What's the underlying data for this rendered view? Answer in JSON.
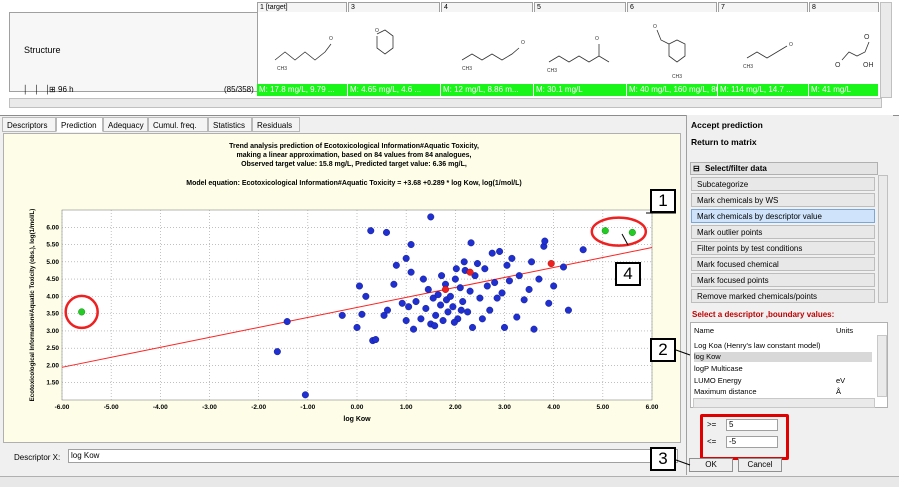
{
  "matrix": {
    "structure_label": "Structure",
    "time_label": "96 h",
    "count_label": "(85/358)",
    "columns": [
      {
        "header": "1 [target]",
        "value": "M: 17.8 mg/L, 9.79 ..."
      },
      {
        "header": "3",
        "value": "M: 4.65 mg/L, 4.6 ..."
      },
      {
        "header": "4",
        "value": "M: 12 mg/L, 8.86 m..."
      },
      {
        "header": "5",
        "value": "M: 30.1 mg/L"
      },
      {
        "header": "6",
        "value": "M: 40 mg/L, 160 mg/L, 80 ..."
      },
      {
        "header": "7",
        "value": "M: 114 mg/L, 14.7 ..."
      },
      {
        "header": "8",
        "value": "M: 41 mg/L"
      }
    ]
  },
  "tabs": [
    {
      "label": "Descriptors"
    },
    {
      "label": "Prediction"
    },
    {
      "label": "Adequacy"
    },
    {
      "label": "Cumul. freq."
    },
    {
      "label": "Statistics"
    },
    {
      "label": "Residuals"
    }
  ],
  "chart_data": {
    "type": "scatter",
    "title_lines": [
      "Trend analysis prediction of Ecotoxicological Information#Aquatic Toxicity,",
      "making a linear approximation, based on 84 values from 84 analogues,",
      "Observed target value: 15.8 mg/L, Predicted target value: 6.36 mg/L,"
    ],
    "equation": "Model equation:  Ecotoxicological Information#Aquatic Toxicity = +3.68 +0.289 * log Kow,  log(1/mol/L)",
    "xlabel": "log Kow",
    "ylabel": "Ecotoxicological Information#Aquatic Toxicity (obs.), log(1/mol/L)",
    "xlim": [
      -6,
      6
    ],
    "ylim": [
      1,
      6.5
    ],
    "xticks": [
      "-6.00",
      "-5.00",
      "-4.00",
      "-3.00",
      "-2.00",
      "-1.00",
      "0.00",
      "1.00",
      "2.00",
      "3.00",
      "4.00",
      "5.00",
      "6.00"
    ],
    "yticks": [
      "1.50",
      "2.00",
      "2.50",
      "3.00",
      "3.50",
      "4.00",
      "4.50",
      "5.00",
      "5.50",
      "6.00"
    ],
    "grid": true,
    "trend_line": {
      "intercept": 3.68,
      "slope": 0.289,
      "color": "#ff2020"
    },
    "colors": {
      "analogue": "#1f2fd0",
      "marked": "#22cc22",
      "target": "#ee2020",
      "highlight": "#ee2020"
    },
    "analogues": [
      {
        "x": -1.62,
        "y": 2.4
      },
      {
        "x": -1.05,
        "y": 1.15
      },
      {
        "x": -1.42,
        "y": 3.27
      },
      {
        "x": 0.0,
        "y": 3.1
      },
      {
        "x": 0.05,
        "y": 4.3
      },
      {
        "x": 0.1,
        "y": 3.48
      },
      {
        "x": 0.18,
        "y": 4.0
      },
      {
        "x": 0.28,
        "y": 5.9
      },
      {
        "x": 0.32,
        "y": 2.72
      },
      {
        "x": 0.38,
        "y": 2.75
      },
      {
        "x": 0.6,
        "y": 5.85
      },
      {
        "x": 0.62,
        "y": 3.6
      },
      {
        "x": 0.75,
        "y": 4.35
      },
      {
        "x": 0.8,
        "y": 4.9
      },
      {
        "x": 0.92,
        "y": 3.8
      },
      {
        "x": 1.0,
        "y": 3.3
      },
      {
        "x": 1.1,
        "y": 4.7
      },
      {
        "x": 1.15,
        "y": 3.05
      },
      {
        "x": 1.2,
        "y": 3.85
      },
      {
        "x": 1.3,
        "y": 3.35
      },
      {
        "x": 1.35,
        "y": 4.5
      },
      {
        "x": 1.4,
        "y": 3.65
      },
      {
        "x": 1.45,
        "y": 4.2
      },
      {
        "x": 1.5,
        "y": 3.2
      },
      {
        "x": 1.55,
        "y": 3.95
      },
      {
        "x": 1.58,
        "y": 3.15
      },
      {
        "x": 1.6,
        "y": 3.45
      },
      {
        "x": 1.65,
        "y": 4.05
      },
      {
        "x": 1.7,
        "y": 3.75
      },
      {
        "x": 1.72,
        "y": 4.6
      },
      {
        "x": 1.75,
        "y": 3.3
      },
      {
        "x": 1.8,
        "y": 4.35
      },
      {
        "x": 1.82,
        "y": 3.9
      },
      {
        "x": 1.85,
        "y": 3.55
      },
      {
        "x": 1.9,
        "y": 4.0
      },
      {
        "x": 1.95,
        "y": 3.7
      },
      {
        "x": 2.0,
        "y": 4.5
      },
      {
        "x": 2.02,
        "y": 4.8
      },
      {
        "x": 2.05,
        "y": 3.35
      },
      {
        "x": 2.1,
        "y": 4.25
      },
      {
        "x": 2.15,
        "y": 3.85
      },
      {
        "x": 2.18,
        "y": 5.0
      },
      {
        "x": 2.2,
        "y": 4.75
      },
      {
        "x": 2.25,
        "y": 3.55
      },
      {
        "x": 2.3,
        "y": 4.15
      },
      {
        "x": 2.35,
        "y": 3.1
      },
      {
        "x": 2.4,
        "y": 4.6
      },
      {
        "x": 2.45,
        "y": 4.95
      },
      {
        "x": 2.5,
        "y": 3.95
      },
      {
        "x": 2.55,
        "y": 3.35
      },
      {
        "x": 2.6,
        "y": 4.8
      },
      {
        "x": 2.65,
        "y": 4.3
      },
      {
        "x": 2.7,
        "y": 3.6
      },
      {
        "x": 2.75,
        "y": 5.25
      },
      {
        "x": 2.8,
        "y": 4.4
      },
      {
        "x": 2.85,
        "y": 3.95
      },
      {
        "x": 2.9,
        "y": 5.3
      },
      {
        "x": 2.95,
        "y": 4.1
      },
      {
        "x": 3.0,
        "y": 3.1
      },
      {
        "x": 3.05,
        "y": 4.9
      },
      {
        "x": 3.1,
        "y": 4.45
      },
      {
        "x": 3.15,
        "y": 5.1
      },
      {
        "x": 3.25,
        "y": 3.4
      },
      {
        "x": 3.3,
        "y": 4.6
      },
      {
        "x": 3.4,
        "y": 3.9
      },
      {
        "x": 3.5,
        "y": 4.2
      },
      {
        "x": 3.6,
        "y": 3.05
      },
      {
        "x": 3.7,
        "y": 4.5
      },
      {
        "x": 3.8,
        "y": 5.45
      },
      {
        "x": 3.82,
        "y": 5.6
      },
      {
        "x": 3.9,
        "y": 3.8
      },
      {
        "x": 4.0,
        "y": 4.3
      },
      {
        "x": 4.2,
        "y": 4.85
      },
      {
        "x": 4.3,
        "y": 3.6
      },
      {
        "x": 4.6,
        "y": 5.35
      },
      {
        "x": -0.3,
        "y": 3.45
      },
      {
        "x": 1.0,
        "y": 5.1
      },
      {
        "x": 1.1,
        "y": 5.5
      },
      {
        "x": 0.55,
        "y": 3.45
      },
      {
        "x": 1.98,
        "y": 3.25
      },
      {
        "x": 2.12,
        "y": 3.6
      },
      {
        "x": 1.05,
        "y": 3.7
      },
      {
        "x": 3.55,
        "y": 5.0
      },
      {
        "x": 2.32,
        "y": 5.55
      },
      {
        "x": 1.5,
        "y": 6.3
      }
    ],
    "marked_points": [
      {
        "x": -5.6,
        "y": 3.55
      },
      {
        "x": 5.05,
        "y": 5.9
      },
      {
        "x": 5.6,
        "y": 5.85
      }
    ],
    "target_points": [
      {
        "x": 1.8,
        "y": 4.2
      },
      {
        "x": 2.3,
        "y": 4.7
      },
      {
        "x": 3.95,
        "y": 4.95
      }
    ]
  },
  "descriptor_x": {
    "label": "Descriptor X:",
    "value": "log Kow"
  },
  "right_panel": {
    "accept_label": "Accept prediction",
    "return_label": "Return to matrix",
    "filter_title": "Select/filter data",
    "filter_items": [
      "Subcategorize",
      "Mark chemicals by WS",
      "Mark chemicals by descriptor value",
      "Mark outlier points",
      "Filter points by test conditions",
      "Mark focused chemical",
      "Mark focused points",
      "Remove marked chemicals/points"
    ],
    "select_descriptor_title": "Select a descriptor ,boundary values:",
    "table_headers": {
      "name": "Name",
      "units": "Units"
    },
    "descriptors": [
      {
        "name": "Log Koa (Henry's law constant model)",
        "units": ""
      },
      {
        "name": "log Kow",
        "units": ""
      },
      {
        "name": "logP Multicase",
        "units": ""
      },
      {
        "name": "LUMO Energy",
        "units": "eV"
      },
      {
        "name": "Maximum distance",
        "units": "Å"
      }
    ],
    "ge_label": ">=",
    "ge_value": "5",
    "le_label": "<=",
    "le_value": "-5",
    "ok_label": "OK",
    "cancel_label": "Cancel"
  },
  "callouts": [
    "1",
    "2",
    "3",
    "4"
  ]
}
